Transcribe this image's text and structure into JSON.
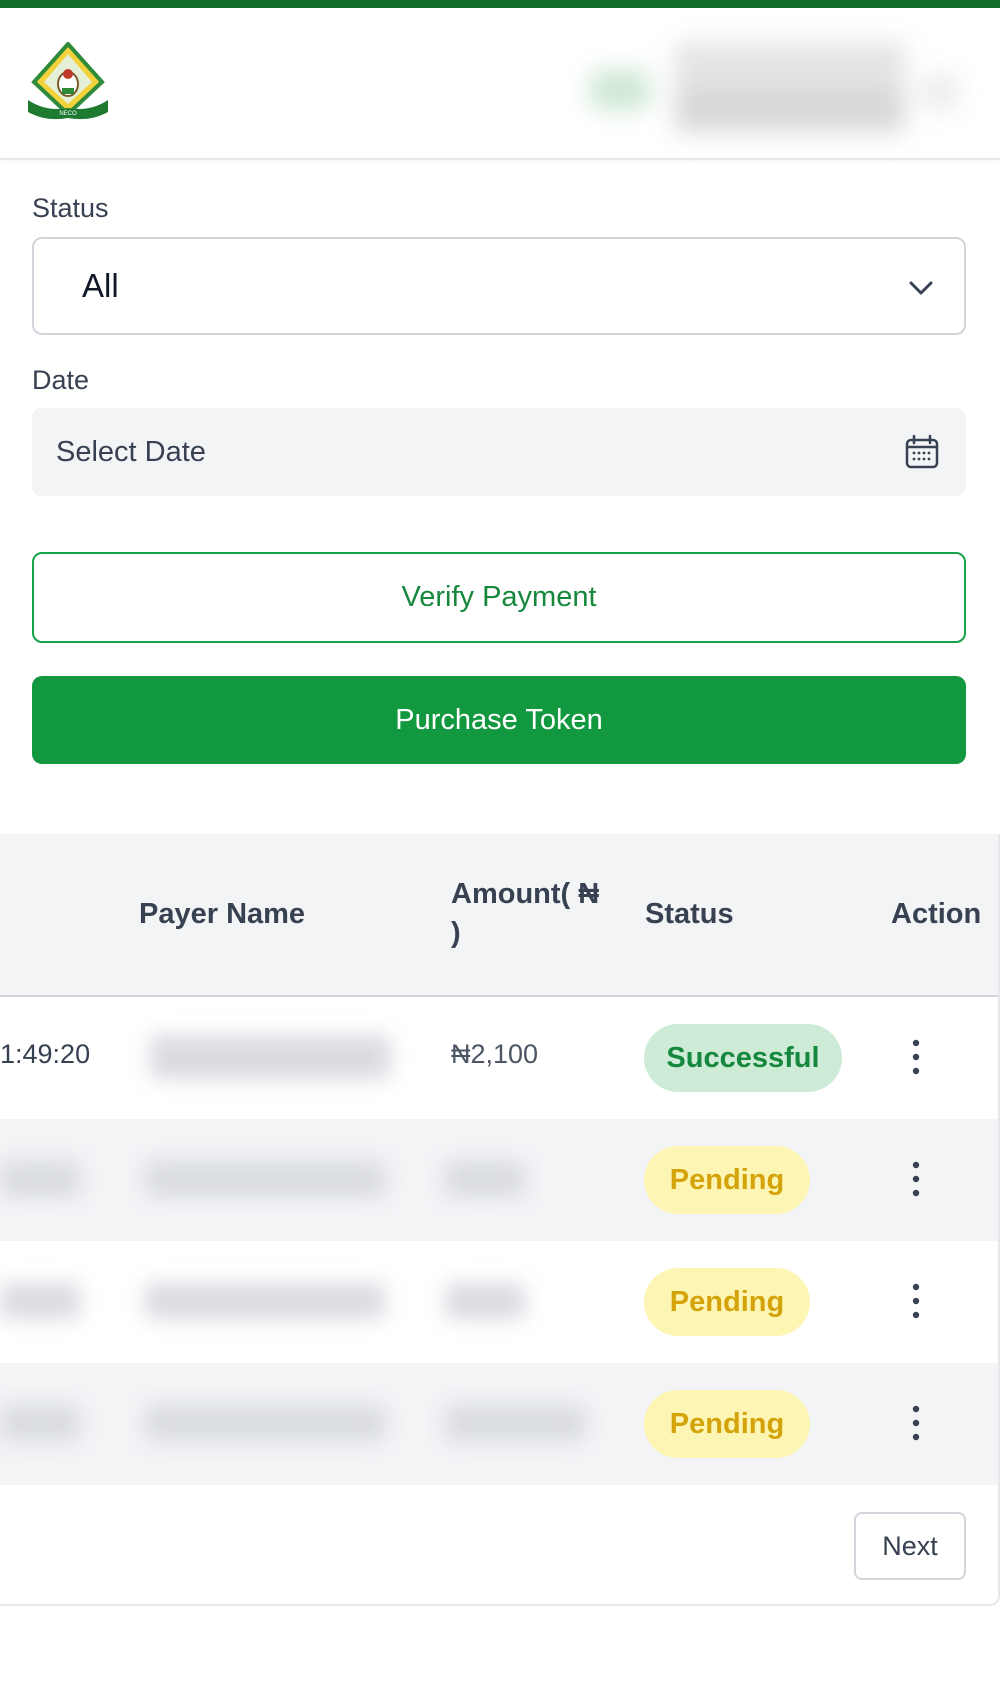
{
  "header": {
    "logo_name": "NECO logo",
    "logo_text": "NECO"
  },
  "filters": {
    "status_label": "Status",
    "status_value": "All",
    "date_label": "Date",
    "date_placeholder": "Select Date"
  },
  "actions": {
    "verify_label": "Verify Payment",
    "purchase_label": "Purchase Token"
  },
  "table": {
    "columns": {
      "payer_name": "Payer Name",
      "amount_line1": "Amount( ₦",
      "amount_line2": ")",
      "status": "Status",
      "action": "Action"
    },
    "rows": [
      {
        "time": "1:49:20",
        "amount": "₦2,100",
        "status": "Successful"
      },
      {
        "time": "",
        "amount": "",
        "status": "Pending"
      },
      {
        "time": "",
        "amount": "",
        "status": "Pending"
      },
      {
        "time": "",
        "amount": "",
        "status": "Pending"
      }
    ]
  },
  "pagination": {
    "next_label": "Next"
  },
  "colors": {
    "brand_green": "#12993f",
    "top_bar": "#0f6b2a",
    "success_bg": "#cdebd6",
    "success_text": "#16883d",
    "pending_bg": "#fdf5b3",
    "pending_text": "#d4a30a"
  }
}
